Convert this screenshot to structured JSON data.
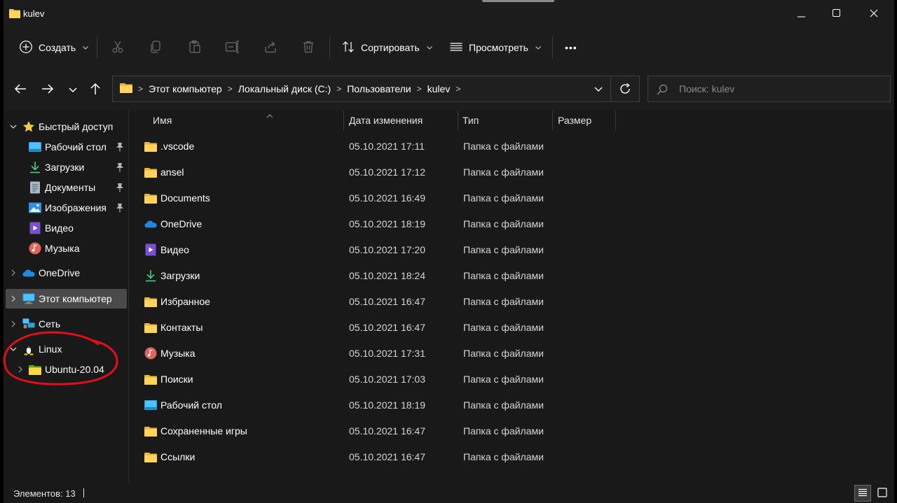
{
  "window": {
    "title": "kulev",
    "controls": [
      "minimize-icon",
      "maximize-icon",
      "close-icon"
    ]
  },
  "toolbar": {
    "create_label": "Создать",
    "sort_label": "Сортировать",
    "view_label": "Просмотреть",
    "more_label": "•••",
    "icons": [
      "cut-icon",
      "copy-icon",
      "paste-icon",
      "rename-icon",
      "share-icon",
      "delete-icon"
    ]
  },
  "address": {
    "crumbs": [
      "Этот компьютер",
      "Локальный диск (C:)",
      "Пользователи",
      "kulev"
    ],
    "separator": ">"
  },
  "search": {
    "placeholder": "Поиск: kulev"
  },
  "sidebar": {
    "items": [
      {
        "label": "Быстрый доступ",
        "icon": "star-icon",
        "expanded": true
      },
      {
        "label": "Рабочий стол",
        "icon": "desktop-icon",
        "pinned": true
      },
      {
        "label": "Загрузки",
        "icon": "download-icon",
        "pinned": true
      },
      {
        "label": "Документы",
        "icon": "document-icon",
        "pinned": true
      },
      {
        "label": "Изображения",
        "icon": "pictures-icon",
        "pinned": true
      },
      {
        "label": "Видео",
        "icon": "video-icon"
      },
      {
        "label": "Музыка",
        "icon": "music-icon"
      },
      {
        "label": "OneDrive",
        "icon": "cloud-icon"
      },
      {
        "label": "Этот компьютер",
        "icon": "computer-icon",
        "selected": true
      },
      {
        "label": "Сеть",
        "icon": "network-icon"
      },
      {
        "label": "Linux",
        "icon": "linux-icon",
        "expanded": true
      },
      {
        "label": "Ubuntu-20.04",
        "icon": "folder-icon"
      }
    ]
  },
  "columns": {
    "name": "Имя",
    "date": "Дата изменения",
    "type": "Тип",
    "size": "Размер"
  },
  "files": [
    {
      "name": ".vscode",
      "date": "05.10.2021 17:11",
      "type": "Папка с файлами",
      "icon": "folder-icon"
    },
    {
      "name": "ansel",
      "date": "05.10.2021 17:12",
      "type": "Папка с файлами",
      "icon": "folder-icon"
    },
    {
      "name": "Documents",
      "date": "05.10.2021 16:49",
      "type": "Папка с файлами",
      "icon": "folder-icon"
    },
    {
      "name": "OneDrive",
      "date": "05.10.2021 18:19",
      "type": "Папка с файлами",
      "icon": "cloud-icon"
    },
    {
      "name": "Видео",
      "date": "05.10.2021 17:20",
      "type": "Папка с файлами",
      "icon": "video-icon"
    },
    {
      "name": "Загрузки",
      "date": "05.10.2021 18:24",
      "type": "Папка с файлами",
      "icon": "download-icon"
    },
    {
      "name": "Избранное",
      "date": "05.10.2021 16:47",
      "type": "Папка с файлами",
      "icon": "folder-icon"
    },
    {
      "name": "Контакты",
      "date": "05.10.2021 16:47",
      "type": "Папка с файлами",
      "icon": "folder-icon"
    },
    {
      "name": "Музыка",
      "date": "05.10.2021 17:31",
      "type": "Папка с файлами",
      "icon": "music-icon"
    },
    {
      "name": "Поиски",
      "date": "05.10.2021 17:03",
      "type": "Папка с файлами",
      "icon": "folder-icon"
    },
    {
      "name": "Рабочий стол",
      "date": "05.10.2021 18:19",
      "type": "Папка с файлами",
      "icon": "desktop-icon"
    },
    {
      "name": "Сохраненные игры",
      "date": "05.10.2021 16:47",
      "type": "Папка с файлами",
      "icon": "folder-icon"
    },
    {
      "name": "Ссылки",
      "date": "05.10.2021 16:47",
      "type": "Папка с файлами",
      "icon": "folder-icon"
    }
  ],
  "status": {
    "items_label": "Элементов: 13"
  },
  "colors": {
    "background": "#191919",
    "chrome": "#1c1c1c",
    "folder": "#f4c542",
    "accent_blue": "#4cc2ff",
    "annotation_red": "#e0101a"
  }
}
